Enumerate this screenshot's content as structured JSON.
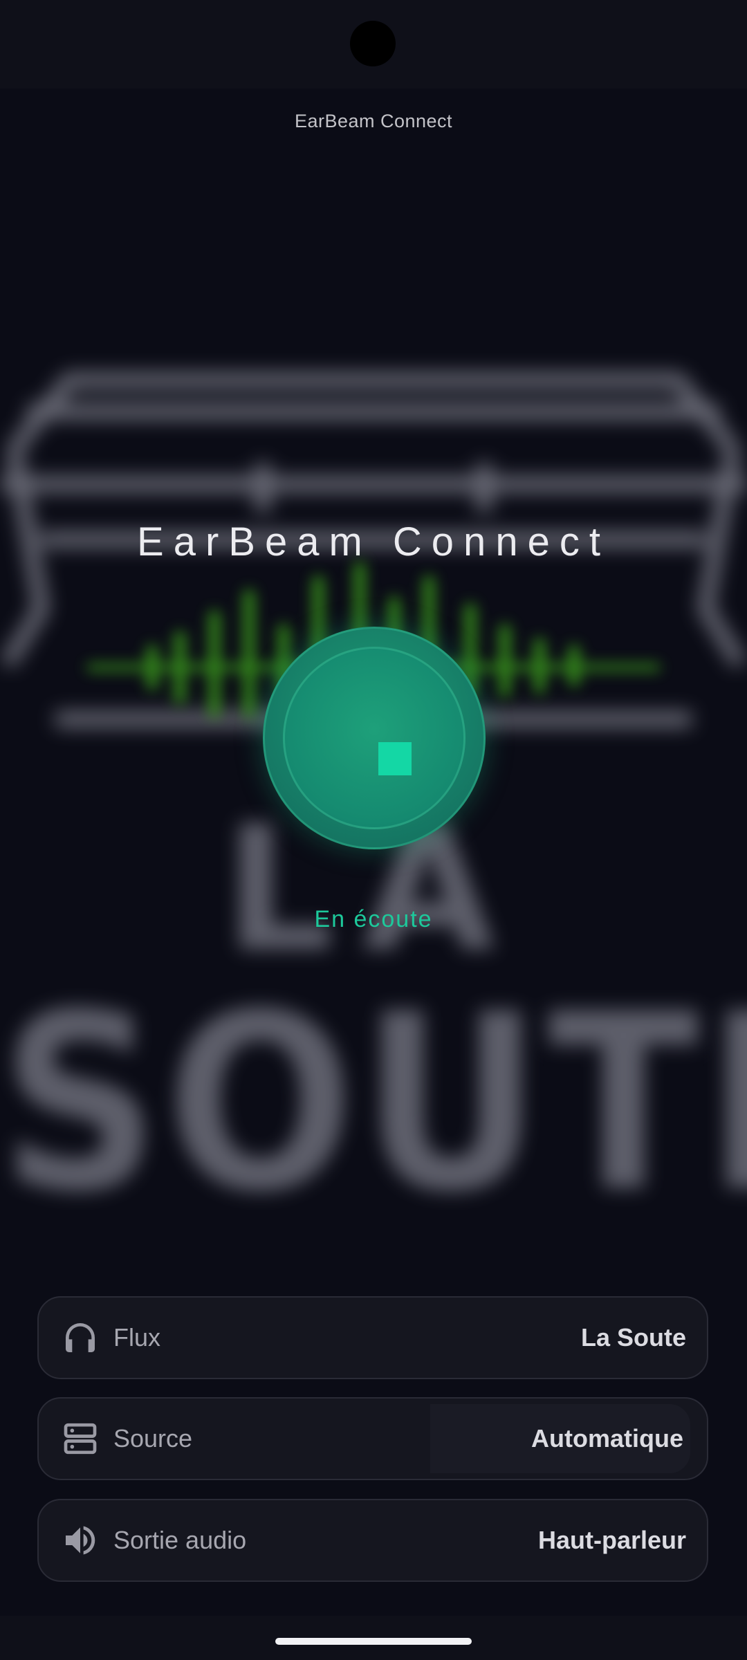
{
  "app": {
    "title": "EarBeam Connect"
  },
  "hero": {
    "title": "EarBeam Connect",
    "status": "En écoute",
    "play_state": "playing",
    "button_icon": "stop-icon"
  },
  "background": {
    "logo_line1": "LA",
    "logo_line2": "SOUTE"
  },
  "settings": [
    {
      "icon": "headphones-icon",
      "label": "Flux",
      "value": "La Soute"
    },
    {
      "icon": "server-icon",
      "label": "Source",
      "value": "Automatique"
    },
    {
      "icon": "speaker-icon",
      "label": "Sortie audio",
      "value": "Haut-parleur"
    }
  ],
  "colors": {
    "accent": "#14d7a5",
    "status_text": "#1dc99b",
    "background": "#0b0c16",
    "card": "#15161f"
  }
}
